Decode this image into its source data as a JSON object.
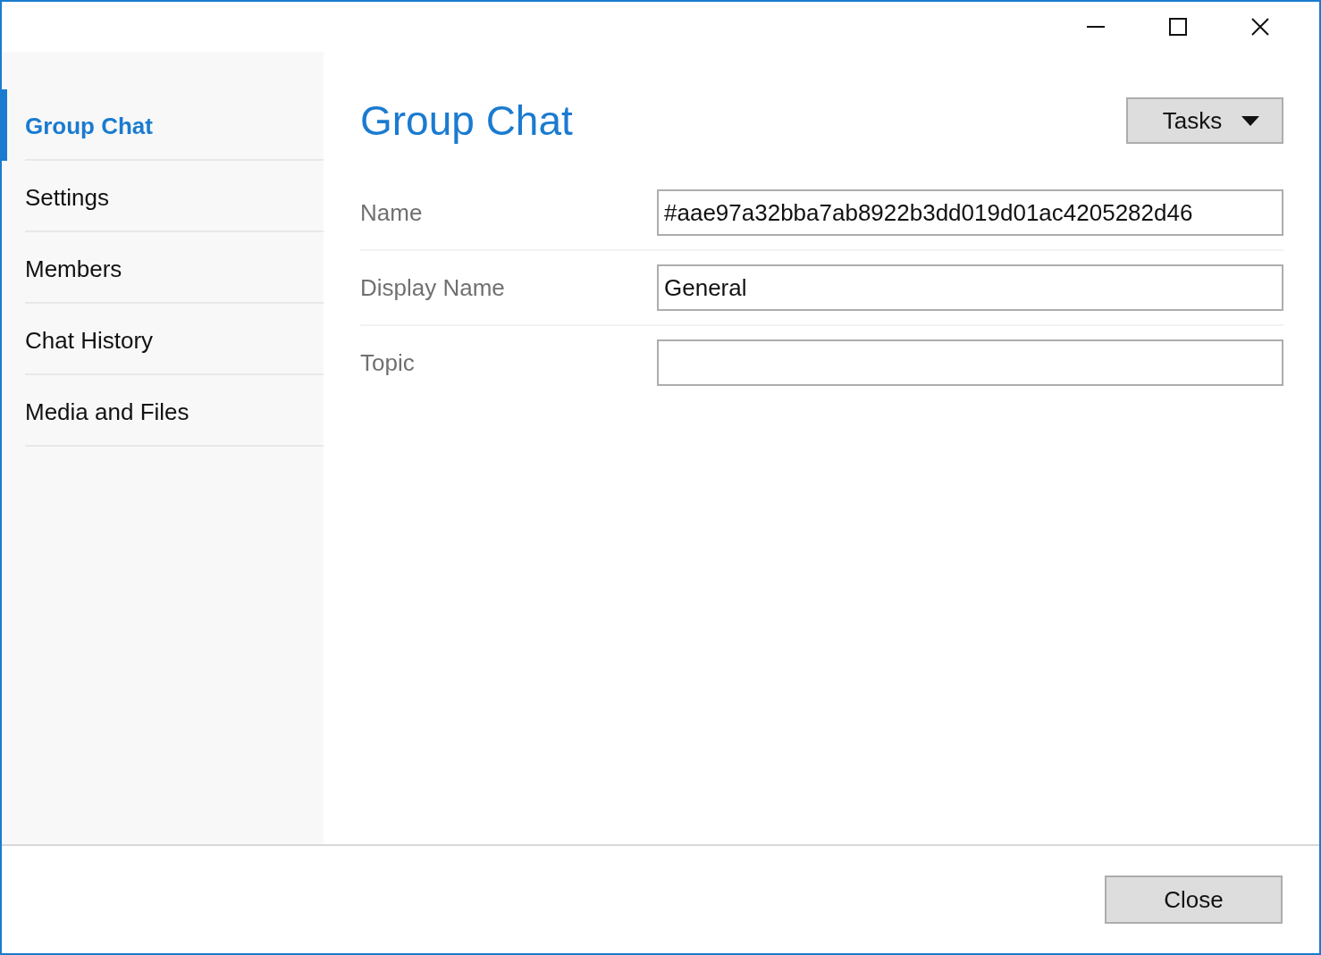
{
  "sidebar": {
    "items": [
      {
        "label": "Group Chat",
        "selected": true
      },
      {
        "label": "Settings",
        "selected": false
      },
      {
        "label": "Members",
        "selected": false
      },
      {
        "label": "Chat History",
        "selected": false
      },
      {
        "label": "Media and Files",
        "selected": false
      }
    ]
  },
  "page": {
    "title": "Group Chat",
    "tasks_button": "Tasks"
  },
  "fields": [
    {
      "label": "Name",
      "value": "#aae97a32bba7ab8922b3dd019d01ac4205282d46"
    },
    {
      "label": "Display Name",
      "value": "General"
    },
    {
      "label": "Topic"
    }
  ],
  "footer": {
    "close_button": "Close"
  }
}
